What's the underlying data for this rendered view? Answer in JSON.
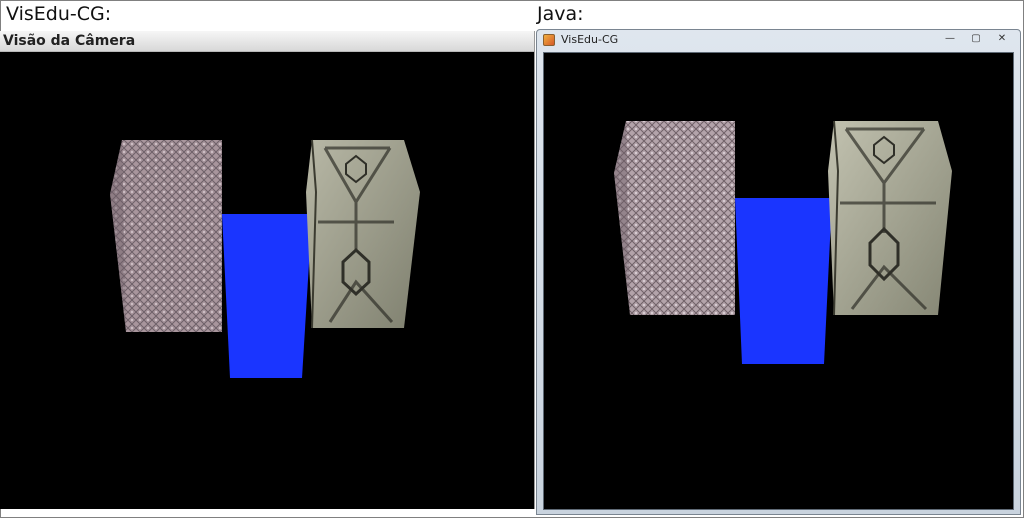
{
  "sections": {
    "left_label": "VisEdu-CG:",
    "right_label": "Java:"
  },
  "left_panel": {
    "title": "Visão da Câmera"
  },
  "java_window": {
    "title": "VisEdu-CG",
    "icon": "java-app-icon",
    "controls": {
      "minimize": "—",
      "maximize": "▢",
      "close": "✕"
    }
  },
  "scene": {
    "objects": [
      "textured-brick-box",
      "blue-box",
      "textured-metal-box"
    ],
    "colors": {
      "background": "#000000",
      "blue_box": "#1a35ff",
      "brick": "#a8959c",
      "metal": "#9a9a88"
    }
  }
}
